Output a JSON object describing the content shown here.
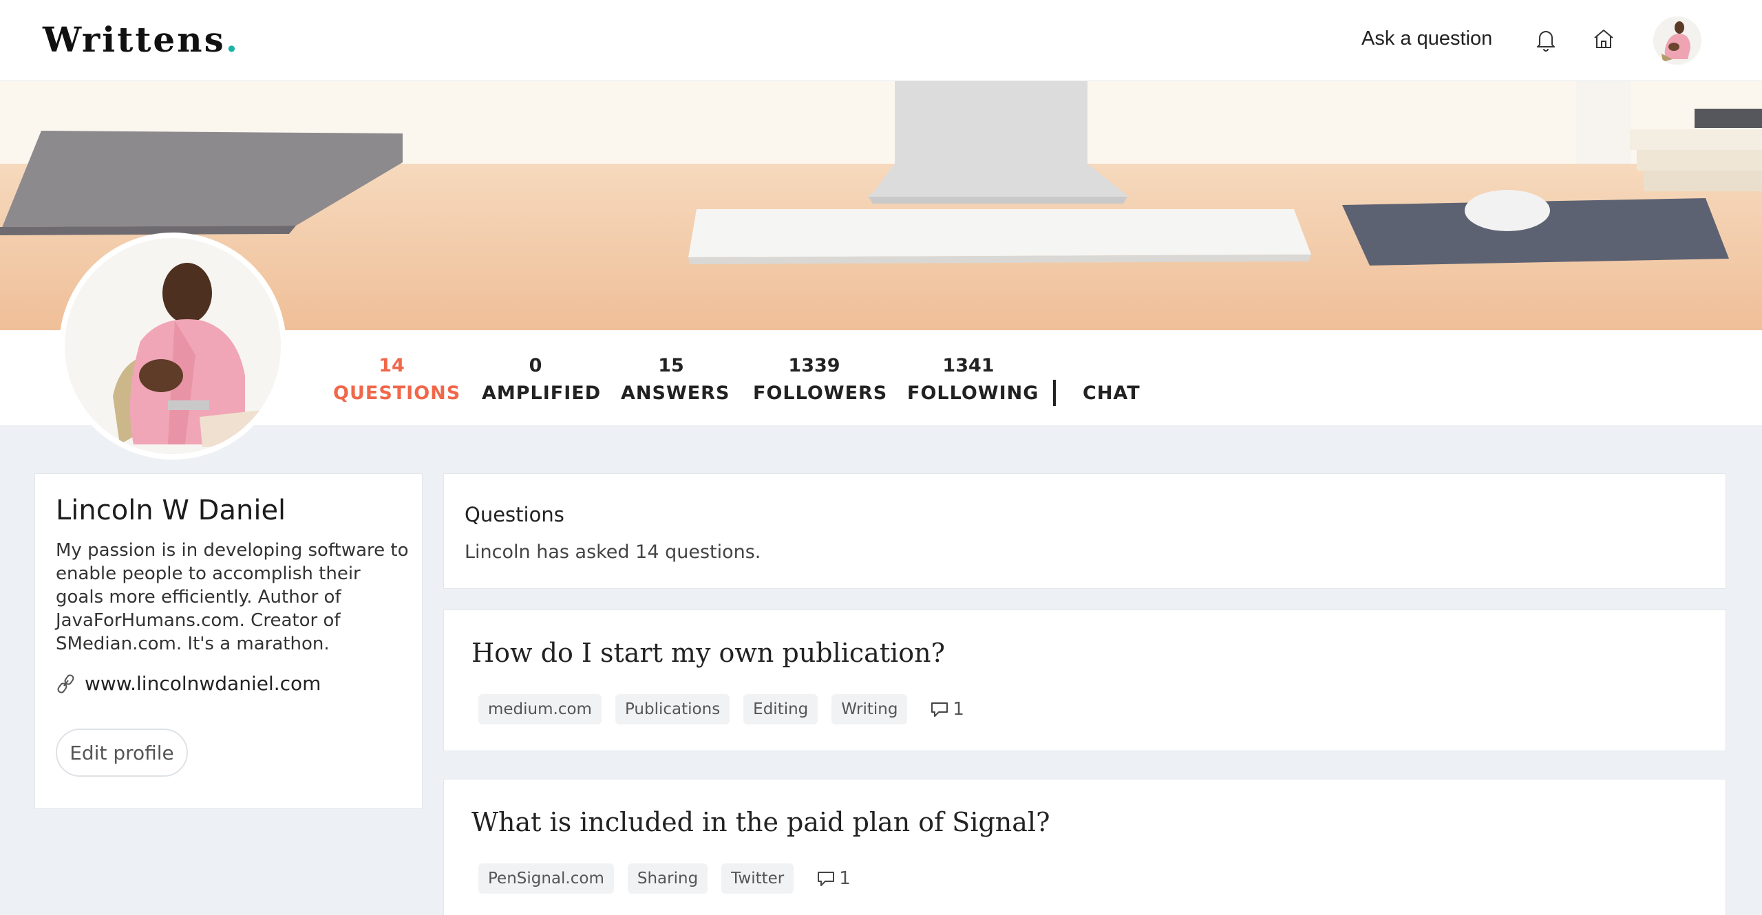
{
  "header": {
    "logo": "Writtens",
    "logo_dot": ".",
    "ask_question": "Ask a question",
    "icons": [
      "bell-icon",
      "home-icon"
    ],
    "accent_color": "#19b4a6"
  },
  "stats": {
    "questions": {
      "count": "14",
      "label": "QUESTIONS"
    },
    "amplified": {
      "count": "0",
      "label": "AMPLIFIED"
    },
    "answers": {
      "count": "15",
      "label": "ANSWERS"
    },
    "followers": {
      "count": "1339",
      "label": "FOLLOWERS"
    },
    "following": {
      "count": "1341",
      "label": "FOLLOWING"
    },
    "chat": "CHAT",
    "active_color": "#f0674a"
  },
  "profile": {
    "name": "Lincoln W Daniel",
    "bio": "My passion is in developing software to enable people to accomplish their goals more efficiently. Author of JavaForHumans.com. Creator of SMedian.com. It's a marathon.",
    "website": "www.lincolnwdaniel.com",
    "edit_button": "Edit profile"
  },
  "summary": {
    "title": "Questions",
    "text": "Lincoln has asked 14 questions."
  },
  "questions": [
    {
      "title": "How do I start my own publication?",
      "tags": [
        "medium.com",
        "Publications",
        "Editing",
        "Writing"
      ],
      "comments": "1"
    },
    {
      "title": "What is included in the paid plan of Signal?",
      "tags": [
        "PenSignal.com",
        "Sharing",
        "Twitter"
      ],
      "comments": "1"
    }
  ]
}
